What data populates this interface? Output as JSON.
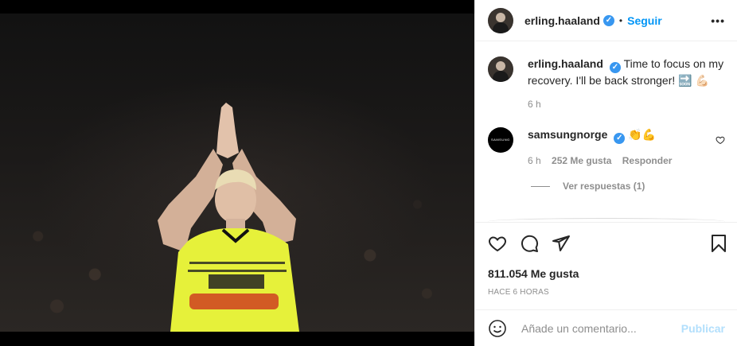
{
  "post": {
    "author": "erling.haaland",
    "verified_glyph": "✓",
    "separator": "•",
    "follow_label": "Seguir",
    "more_glyph": "•••"
  },
  "caption": {
    "username": "erling.haaland",
    "text": "Time to focus on my recovery. I'll be back stronger!",
    "emoji": "🔜 💪🏻",
    "time": "6 h"
  },
  "comments": [
    {
      "username": "samsungnorge",
      "avatar_text": "SAMSUNG",
      "emoji": "👏💪",
      "time": "6 h",
      "likes": "252 Me gusta",
      "reply_label": "Responder",
      "view_replies": "Ver respuestas (1)"
    }
  ],
  "engagement": {
    "likes": "811.054 Me gusta",
    "posted": "Hace 6 horas"
  },
  "composer": {
    "placeholder": "Añade un comentario...",
    "publish_label": "Publicar"
  },
  "icons": [
    "more-icon",
    "heart-icon",
    "comment-icon",
    "share-icon",
    "bookmark-icon",
    "emoji-icon",
    "verified-icon"
  ],
  "colors": {
    "accent": "#0095f6",
    "verified": "#3897f0",
    "jersey": "#e6f13a",
    "muted": "#8e8e8e"
  }
}
